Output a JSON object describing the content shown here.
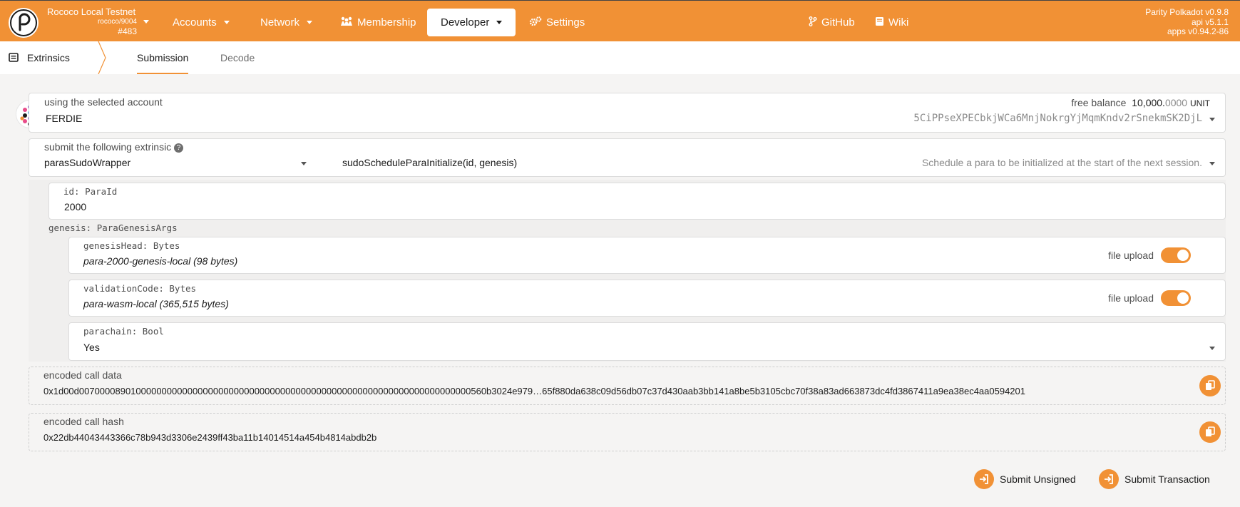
{
  "chain": {
    "name": "Rococo Local Testnet",
    "spec": "rococo/9004",
    "block": "#483"
  },
  "nav": {
    "accounts": "Accounts",
    "network": "Network",
    "membership": "Membership",
    "developer": "Developer",
    "settings": "Settings",
    "github": "GitHub",
    "wiki": "Wiki"
  },
  "version": {
    "app": "Parity Polkadot v0.9.8",
    "api": "api v5.1.1",
    "apps": "apps v0.94.2-86"
  },
  "subnav": {
    "section": "Extrinsics",
    "tabs": [
      "Submission",
      "Decode"
    ],
    "active_tab": "Submission"
  },
  "account": {
    "label": "using the selected account",
    "name": "FERDIE",
    "balance_label": "free balance",
    "balance_int": "10,000.",
    "balance_dec": "0000",
    "unit": "UNIT",
    "address": "5CiPPseXPECbkjWCa6MnjNokrgYjMqmKndv2rSnekmSK2DjL"
  },
  "extrinsic": {
    "label": "submit the following extrinsic",
    "module": "parasSudoWrapper",
    "method": "sudoScheduleParaInitialize(id, genesis)",
    "description": "Schedule a para to be initialized at the start of the next session."
  },
  "params": {
    "id": {
      "label": "id: ParaId",
      "value": "2000"
    },
    "genesis_label": "genesis: ParaGenesisArgs",
    "genesis_head": {
      "label": "genesisHead: Bytes",
      "value": "para-2000-genesis-local (98 bytes)",
      "toggle_label": "file upload"
    },
    "validation_code": {
      "label": "validationCode: Bytes",
      "value": "para-wasm-local (365,515 bytes)",
      "toggle_label": "file upload"
    },
    "parachain": {
      "label": "parachain: Bool",
      "value": "Yes"
    }
  },
  "encoded": {
    "call_data_label": "encoded call data",
    "call_data": "0x1d00d0070000890100000000000000000000000000000000000000000000000000000000000000000560b3024e979…65f880da638c09d56db07c37d430aab3bb141a8be5b3105cbc70f38a83ad663873dc4fd3867411a9ea38ec4aa0594201",
    "call_hash_label": "encoded call hash",
    "call_hash": "0x22db44043443366c78b943d3306e2439ff43ba11b14014514a454b4814abdb2b"
  },
  "actions": {
    "submit_unsigned": "Submit Unsigned",
    "submit_transaction": "Submit Transaction"
  },
  "colors": {
    "accent": "#f19135",
    "background": "#f5f4f3"
  }
}
